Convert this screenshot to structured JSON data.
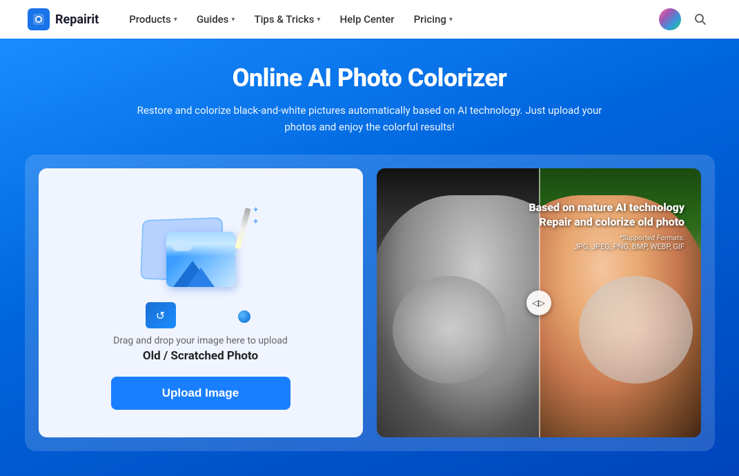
{
  "navbar": {
    "logo_text": "Repairit",
    "nav_items": [
      {
        "label": "Products",
        "has_dropdown": true
      },
      {
        "label": "Guides",
        "has_dropdown": true
      },
      {
        "label": "Tips & Tricks",
        "has_dropdown": true
      },
      {
        "label": "Help Center",
        "has_dropdown": false
      },
      {
        "label": "Pricing",
        "has_dropdown": true
      }
    ],
    "search_icon": "🔍"
  },
  "hero": {
    "title": "Online AI Photo Colorizer",
    "subtitle": "Restore and colorize black-and-white pictures automatically based on AI technology. Just upload your photos and enjoy the colorful results!"
  },
  "upload_panel": {
    "drag_text": "Drag and drop your image here to upload",
    "file_type_text": "Old / Scratched Photo",
    "upload_button_label": "Upload Image"
  },
  "preview_panel": {
    "overlay_title_line1": "Based on mature AI technology",
    "overlay_title_line2": "Repair and colorize old photo",
    "formats_label": "*Supported Formats:",
    "formats_value": "JPG, JPEG, PNG, BMP, WEBP, GIF"
  }
}
